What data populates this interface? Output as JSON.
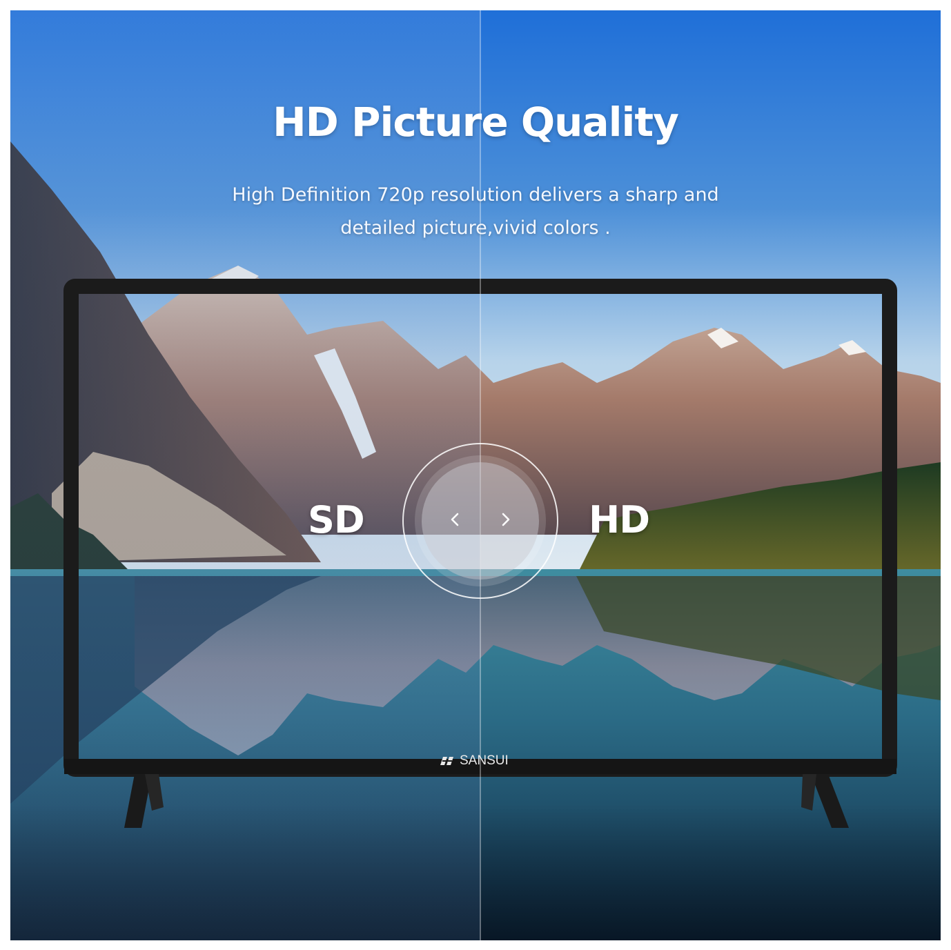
{
  "headline": "HD Picture Quality",
  "description": {
    "line1": "High Definition 720p resolution delivers a sharp and",
    "line2": "detailed picture,vivid colors ."
  },
  "comparison": {
    "left_label": "SD",
    "right_label": "HD",
    "handle_icon_left": "chevron-left-icon",
    "handle_icon_right": "chevron-right-icon"
  },
  "tv": {
    "brand": "SANSUI",
    "brand_icon": "sansui-logo-icon"
  },
  "colors": {
    "sky_top": "#1f6fd8",
    "sky_bottom": "#9fc6ea",
    "bezel": "#1b1b1b",
    "text": "#ffffff"
  }
}
